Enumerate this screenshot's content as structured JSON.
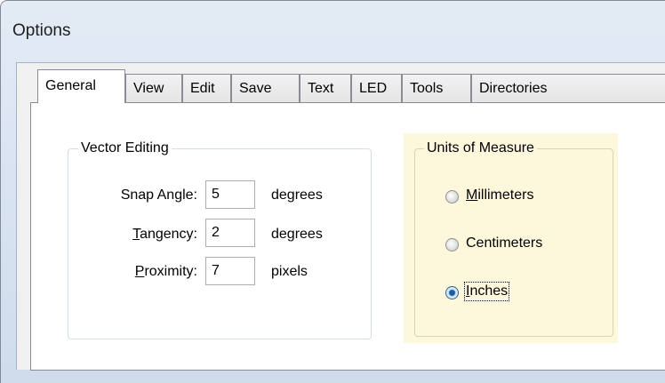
{
  "window": {
    "title": "Options"
  },
  "tabs": [
    {
      "label": "General",
      "active": true
    },
    {
      "label": "View"
    },
    {
      "label": "Edit"
    },
    {
      "label": "Save"
    },
    {
      "label": "Text"
    },
    {
      "label": "LED"
    },
    {
      "label": "Tools"
    },
    {
      "label": "Directories"
    }
  ],
  "vector_editing": {
    "title": "Vector Editing",
    "snap_angle": {
      "label": "Snap Angle:",
      "value": "5",
      "unit": "degrees"
    },
    "tangency": {
      "label": "Tangency:",
      "value": "2",
      "unit": "degrees"
    },
    "proximity": {
      "label": "Proximity:",
      "value": "7",
      "unit": "pixels"
    }
  },
  "units_of_measure": {
    "title": "Units of Measure",
    "options": [
      {
        "label": "Millimeters",
        "checked": false
      },
      {
        "label": "Centimeters",
        "checked": false
      },
      {
        "label": "Inches",
        "checked": true
      }
    ]
  },
  "colors": {
    "units_highlight": "#fdf7dc",
    "radio_selected": "#1b5f9e"
  }
}
